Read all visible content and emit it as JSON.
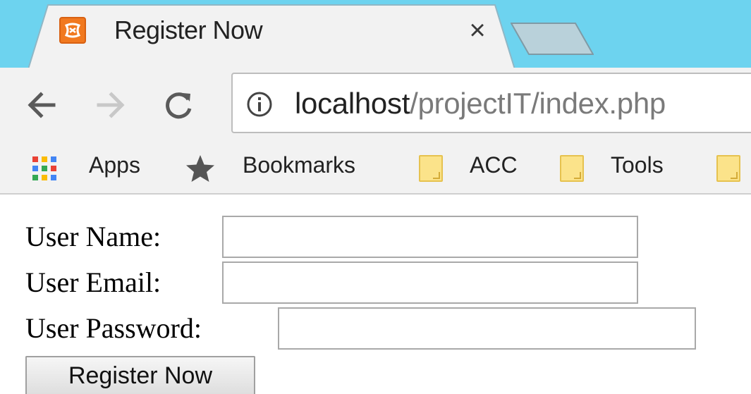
{
  "browser": {
    "tab": {
      "title": "Register Now",
      "close_glyph": "×",
      "favicon": "xampp-icon"
    },
    "toolbar": {
      "back_icon": "arrow-left-icon",
      "forward_icon": "arrow-right-icon",
      "reload_icon": "reload-icon",
      "url_host": "localhost",
      "url_path": "/projectIT/index.php"
    },
    "bookmarks": [
      {
        "label": "Apps",
        "icon": "apps-grid-icon"
      },
      {
        "label": "Bookmarks",
        "icon": "star-icon"
      },
      {
        "label": "ACC",
        "icon": "folder-icon"
      },
      {
        "label": "Tools",
        "icon": "folder-icon"
      }
    ],
    "colors": {
      "tabstrip": "#6dd3ef",
      "toolbar": "#f2f2f2",
      "favicon": "#f1791f",
      "folder": "#fbe38a"
    }
  },
  "form": {
    "fields": [
      {
        "label": "User Name:",
        "value": ""
      },
      {
        "label": "User Email:",
        "value": ""
      },
      {
        "label": "User Password:",
        "value": ""
      }
    ],
    "submit_label": "Register Now"
  }
}
